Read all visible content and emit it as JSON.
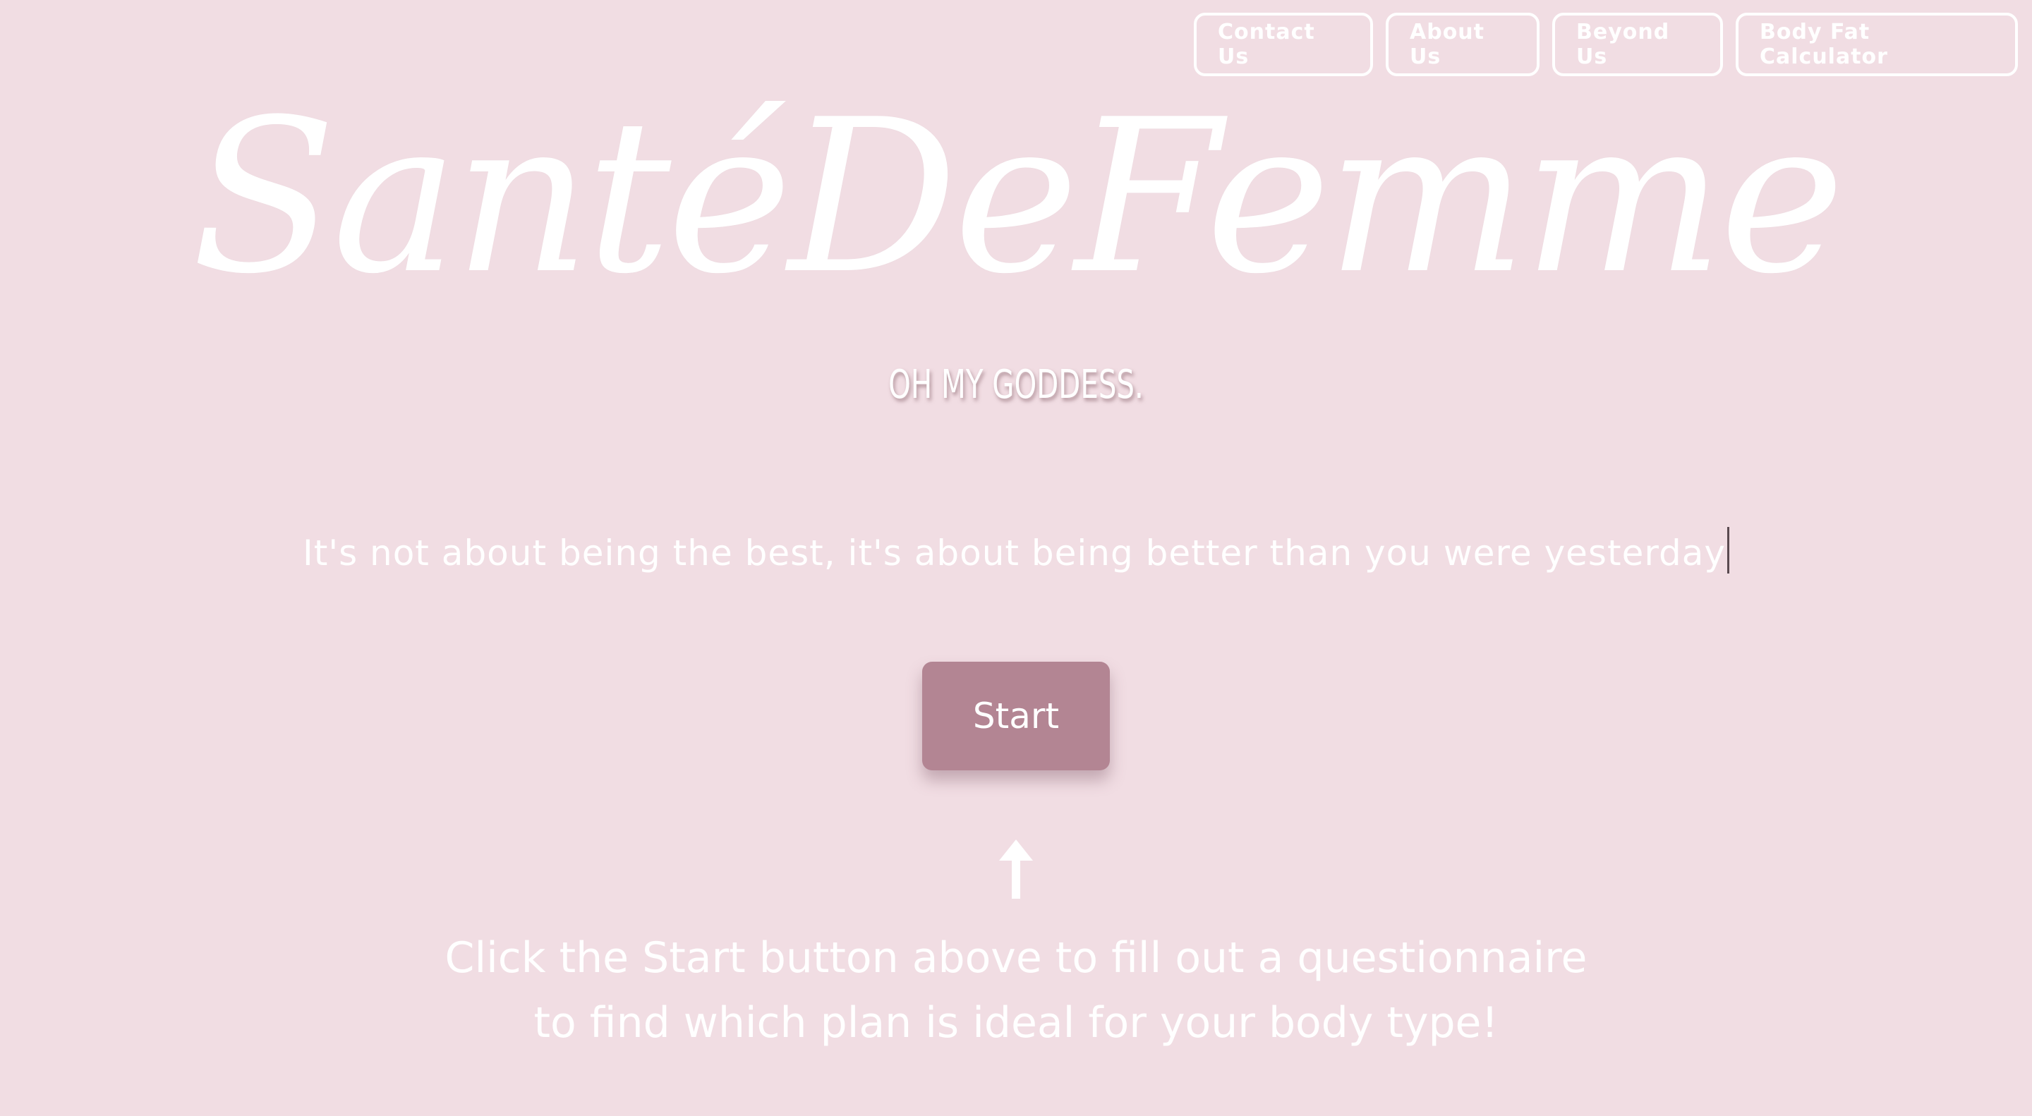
{
  "nav": {
    "contact_label": "Contact Us",
    "about_label": "About Us",
    "beyond_label": "Beyond Us",
    "calculator_label": "Body Fat Calculator"
  },
  "hero": {
    "logo_text": "SantéDeFemme",
    "tagline": "OH MY GODDESS.",
    "quote": "It's not about being the best, it's about being better than you were yesterday"
  },
  "start_button": {
    "label": "Start"
  },
  "instruction": {
    "line1": "Click the Start button above to fill out a questionnaire",
    "line2": "to find which plan is ideal for your body type!"
  },
  "colors": {
    "background": "#f1dde3",
    "button": "#b38593",
    "text": "#ffffff"
  },
  "icons": {
    "arrow": "arrow-up-icon"
  }
}
